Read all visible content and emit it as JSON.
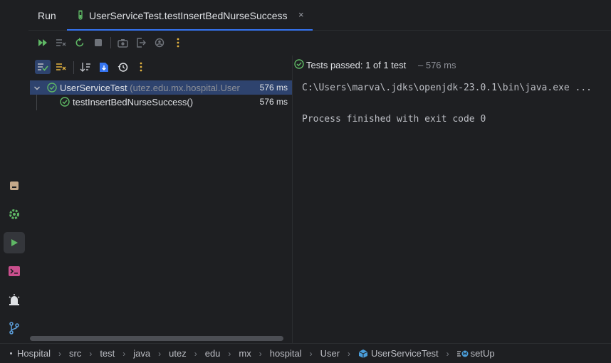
{
  "run_window": {
    "title": "Run",
    "tab": {
      "label": "UserServiceTest.testInsertBedNurseSuccess",
      "close": "×"
    }
  },
  "toolbar": {
    "icons": [
      "rerun-failed-icon",
      "stop-all-icon",
      "rerun-icon",
      "stop-icon",
      "screenshot-icon",
      "exit-icon",
      "coverage-icon",
      "more-icon"
    ]
  },
  "test_tree": {
    "tools": [
      "show-passed-icon",
      "show-ignored-icon",
      "sort-icon",
      "import-tests-icon",
      "history-icon",
      "more-icon"
    ],
    "root": {
      "name": "UserServiceTest",
      "package": "(utez.edu.mx.hospital.User",
      "duration": "576 ms",
      "status": "passed"
    },
    "children": [
      {
        "name": "testInsertBedNurseSuccess()",
        "duration": "576 ms",
        "status": "passed"
      }
    ]
  },
  "console": {
    "status": "Tests passed: 1 of 1 test",
    "timing": "– 576 ms",
    "lines": [
      "C:\\Users\\marva\\.jdks\\openjdk-23.0.1\\bin\\java.exe ...",
      "",
      "Process finished with exit code 0"
    ]
  },
  "breadcrumbs": [
    "Hospital",
    "src",
    "test",
    "java",
    "utez",
    "edu",
    "mx",
    "hospital",
    "User",
    "UserServiceTest",
    "setUp"
  ],
  "stripe": [
    "bookmarks-icon",
    "services-icon",
    "run-icon",
    "terminal-icon",
    "problems-icon",
    "git-icon"
  ],
  "colors": {
    "accent": "#3574f0",
    "passed": "#5fb865",
    "selection": "#2e436e",
    "background": "#1e1f22"
  }
}
